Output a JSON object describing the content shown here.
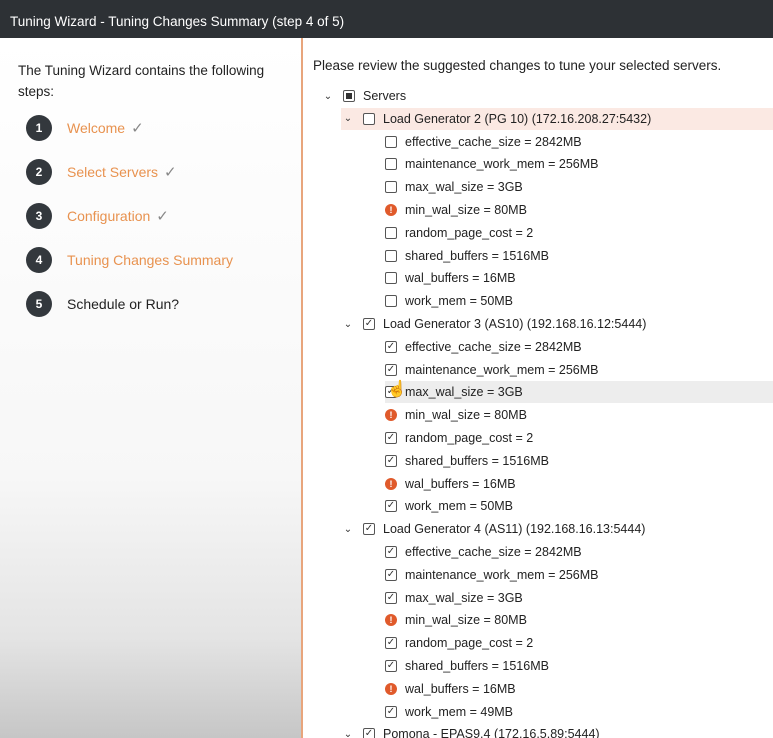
{
  "window": {
    "title": "Tuning Wizard - Tuning Changes Summary (step 4 of 5)"
  },
  "sidebar": {
    "intro": "The Tuning Wizard contains the following steps:",
    "steps": [
      {
        "number": "1",
        "label": "Welcome",
        "status": "done",
        "check": "✓"
      },
      {
        "number": "2",
        "label": "Select Servers",
        "status": "done",
        "check": "✓"
      },
      {
        "number": "3",
        "label": "Configuration",
        "status": "done",
        "check": "✓"
      },
      {
        "number": "4",
        "label": "Tuning Changes Summary",
        "status": "current",
        "check": ""
      },
      {
        "number": "5",
        "label": "Schedule or Run?",
        "status": "pending",
        "check": ""
      }
    ]
  },
  "main": {
    "review_text": "Please review the suggested changes to tune your selected servers.",
    "tree": {
      "root_label": "Servers",
      "servers": [
        {
          "label": "Load Generator 2 (PG 10) (172.16.208.27:5432)",
          "state": "unchecked",
          "params": [
            {
              "label": "effective_cache_size = 2842MB",
              "state": "unchecked"
            },
            {
              "label": "maintenance_work_mem = 256MB",
              "state": "unchecked"
            },
            {
              "label": "max_wal_size = 3GB",
              "state": "unchecked"
            },
            {
              "label": "min_wal_size = 80MB",
              "state": "warning"
            },
            {
              "label": "random_page_cost = 2",
              "state": "unchecked"
            },
            {
              "label": "shared_buffers = 1516MB",
              "state": "unchecked"
            },
            {
              "label": "wal_buffers = 16MB",
              "state": "unchecked"
            },
            {
              "label": "work_mem = 50MB",
              "state": "unchecked"
            }
          ]
        },
        {
          "label": "Load Generator 3 (AS10) (192.168.16.12:5444)",
          "state": "checked",
          "params": [
            {
              "label": "effective_cache_size = 2842MB",
              "state": "checked"
            },
            {
              "label": "maintenance_work_mem = 256MB",
              "state": "checked"
            },
            {
              "label": "max_wal_size = 3GB",
              "state": "checked"
            },
            {
              "label": "min_wal_size = 80MB",
              "state": "warning"
            },
            {
              "label": "random_page_cost = 2",
              "state": "checked"
            },
            {
              "label": "shared_buffers = 1516MB",
              "state": "checked"
            },
            {
              "label": "wal_buffers = 16MB",
              "state": "warning"
            },
            {
              "label": "work_mem = 50MB",
              "state": "checked"
            }
          ]
        },
        {
          "label": "Load Generator 4 (AS11) (192.168.16.13:5444)",
          "state": "checked",
          "params": [
            {
              "label": "effective_cache_size = 2842MB",
              "state": "checked"
            },
            {
              "label": "maintenance_work_mem = 256MB",
              "state": "checked"
            },
            {
              "label": "max_wal_size = 3GB",
              "state": "checked"
            },
            {
              "label": "min_wal_size = 80MB",
              "state": "warning"
            },
            {
              "label": "random_page_cost = 2",
              "state": "checked"
            },
            {
              "label": "shared_buffers = 1516MB",
              "state": "checked"
            },
            {
              "label": "wal_buffers = 16MB",
              "state": "warning"
            },
            {
              "label": "work_mem = 49MB",
              "state": "checked"
            }
          ]
        },
        {
          "label": "Pomona - EPAS9.4 (172.16.5.89:5444)",
          "state": "checked",
          "params": []
        }
      ]
    }
  },
  "colors": {
    "accent": "#e8924f",
    "warning": "#e05a2b",
    "titlebar": "#2d3135"
  }
}
